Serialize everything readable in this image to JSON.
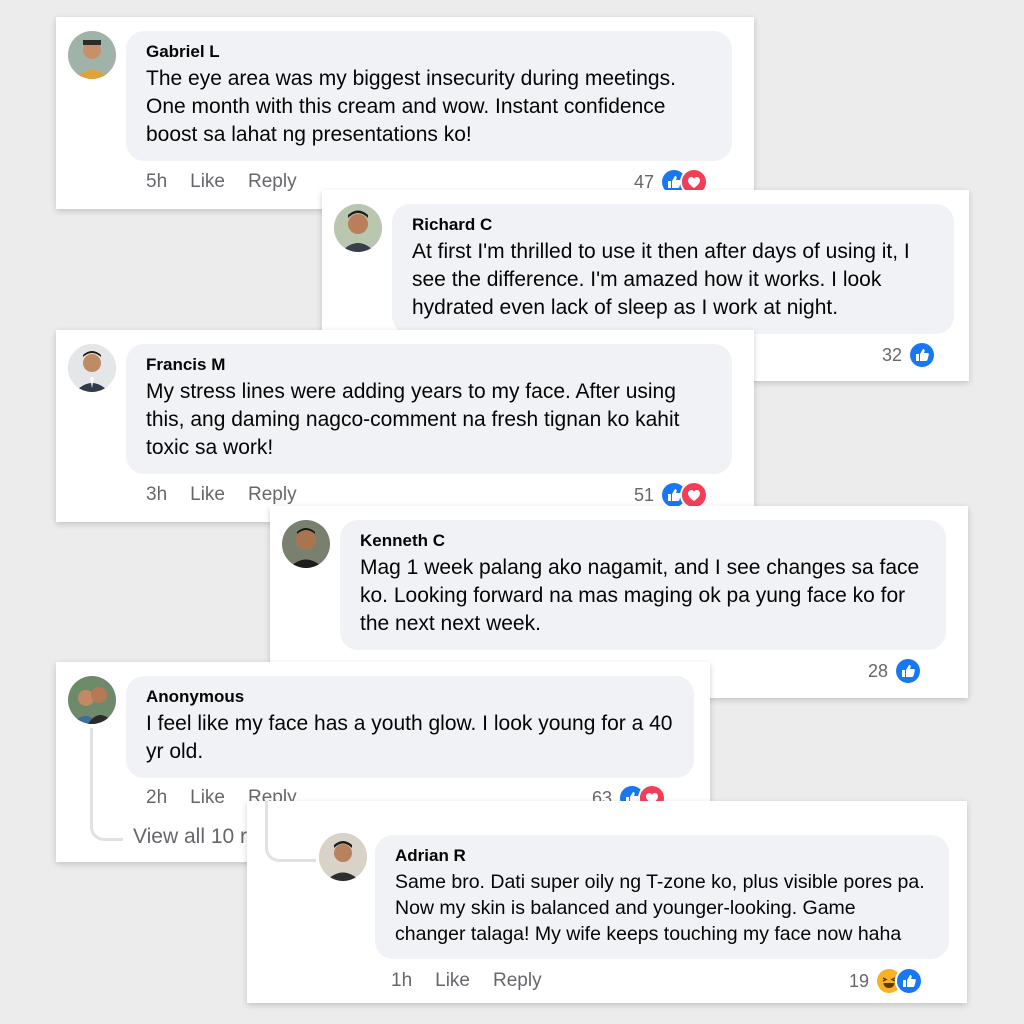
{
  "colors": {
    "like_blue": "#1877f2",
    "love_red": "#f33e58",
    "haha_yellow": "#f7b125",
    "bubble": "#f0f2f5",
    "meta_gray": "#65676b"
  },
  "like_label": "Like",
  "reply_label": "Reply",
  "comments": [
    {
      "author": "Gabriel L",
      "text": "The eye area was my biggest insecurity during meetings. One month with this cream and wow. Instant confidence boost sa lahat ng presentations ko!",
      "time": "5h",
      "count": "47",
      "reactions": [
        "like-icon",
        "love-icon"
      ]
    },
    {
      "author": "Richard C",
      "text": "At first I'm thrilled to use it then after days of using it, I see the difference. I'm amazed how it works. I look hydrated even lack of sleep as I work at night.",
      "count": "32",
      "reactions": [
        "like-icon"
      ]
    },
    {
      "author": "Francis M",
      "text": "My stress lines were adding years to my face. After using this, ang daming nagco-comment na fresh tignan ko kahit toxic sa work!",
      "time": "3h",
      "count": "51",
      "reactions": [
        "like-icon",
        "love-icon"
      ]
    },
    {
      "author": "Kenneth C",
      "text": "Mag 1 week palang ako nagamit, and I see changes sa face ko. Looking forward na mas maging ok pa yung face ko for the next next week.",
      "count": "28",
      "reactions": [
        "like-icon"
      ]
    },
    {
      "author": "Anonymous",
      "text": "I feel like my face has a youth glow. I look young for a 40 yr old.",
      "time": "2h",
      "count": "63",
      "reactions": [
        "like-icon",
        "love-icon"
      ],
      "view_all": "View all 10 r"
    },
    {
      "author": "Adrian R",
      "text": "Same bro. Dati super oily ng T-zone ko, plus visible pores pa. Now my skin is balanced and younger-looking. Game changer talaga! My wife keeps touching my face now haha",
      "time": "1h",
      "count": "19",
      "reactions": [
        "haha-icon",
        "like-icon"
      ]
    }
  ]
}
